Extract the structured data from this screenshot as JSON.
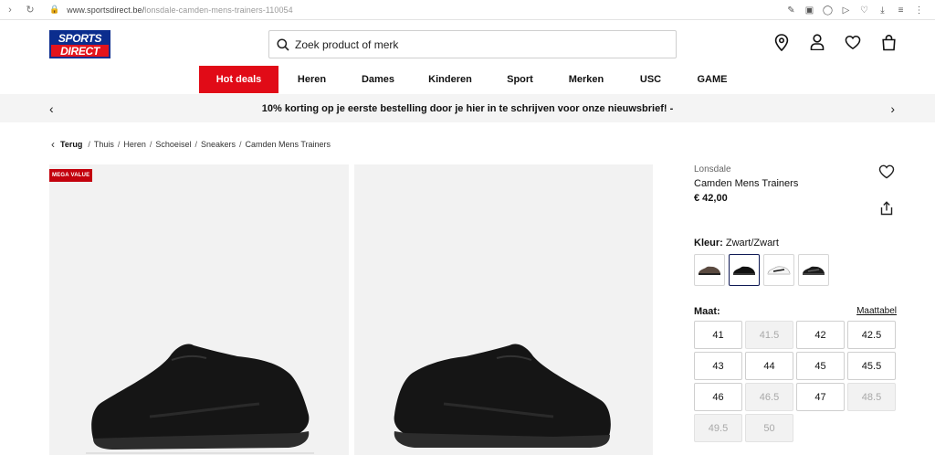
{
  "browser": {
    "url_domain": "www.sportsdirect.be/",
    "url_path": "lonsdale-camden-mens-trainers-110054"
  },
  "header": {
    "logo_line1": "SPORTS",
    "logo_line2": "DIRECT",
    "search_placeholder": "Zoek product of merk"
  },
  "nav": [
    {
      "label": "Hot deals",
      "width": 87
    },
    {
      "label": "Heren",
      "width": 73
    },
    {
      "label": "Dames",
      "width": 72
    },
    {
      "label": "Kinderen",
      "width": 86
    },
    {
      "label": "Sport",
      "width": 67
    },
    {
      "label": "Merken",
      "width": 78
    },
    {
      "label": "USC",
      "width": 63
    },
    {
      "label": "GAME",
      "width": 72
    }
  ],
  "promo": {
    "text": "10% korting op je eerste bestelling door je hier in te schrijven voor onze nieuwsbrief!  -"
  },
  "breadcrumb": {
    "back": "Terug",
    "items": [
      "Thuis",
      "Heren",
      "Schoeisel",
      "Sneakers",
      "Camden Mens Trainers"
    ]
  },
  "gallery": {
    "badge": "MEGA VALUE"
  },
  "product": {
    "brand": "Lonsdale",
    "name": "Camden Mens Trainers",
    "price": "€ 42,00",
    "color_label": "Kleur:",
    "color_value": "Zwart/Zwart",
    "size_label": "Maat:",
    "size_guide": "Maattabel",
    "sizes": [
      {
        "label": "41",
        "available": true
      },
      {
        "label": "41.5",
        "available": false
      },
      {
        "label": "42",
        "available": true
      },
      {
        "label": "42.5",
        "available": true
      },
      {
        "label": "43",
        "available": true
      },
      {
        "label": "44",
        "available": true
      },
      {
        "label": "45",
        "available": true
      },
      {
        "label": "45.5",
        "available": true
      },
      {
        "label": "46",
        "available": true
      },
      {
        "label": "46.5",
        "available": false
      },
      {
        "label": "47",
        "available": true
      },
      {
        "label": "48.5",
        "available": false
      },
      {
        "label": "49.5",
        "available": false
      },
      {
        "label": "50",
        "available": false
      }
    ]
  },
  "colors": {
    "brand_red": "#e10b17",
    "brand_blue": "#0b2d8e",
    "promo_bg": "#f4f4f4"
  }
}
